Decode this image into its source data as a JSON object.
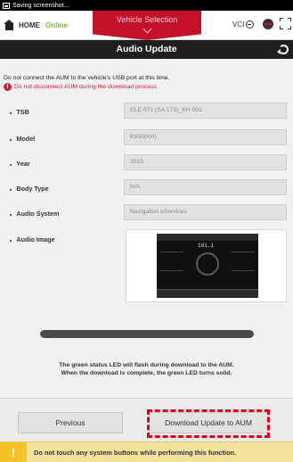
{
  "statusbar": {
    "text": "Saving screenshot..."
  },
  "nav": {
    "home_label": "HOME",
    "online_label": "Online",
    "vehicle_selection_label": "Vehicle Selection",
    "vci_label": "VCI"
  },
  "title": "Audio Update",
  "notices": {
    "line1": "Do not connect the AUM to the vehicle's USB port at this time.",
    "line2": "Do not disconnect AUM during the download process."
  },
  "fields": [
    {
      "label": "TSB",
      "value": "ELE 071 (SA 173)_KH 001"
    },
    {
      "label": "Model",
      "value": "K900(KH)"
    },
    {
      "label": "Year",
      "value": "2015"
    },
    {
      "label": "Body Type",
      "value": "N/A"
    },
    {
      "label": "Audio System",
      "value": "Navigation eServices"
    }
  ],
  "audio_image": {
    "label": "Audio Image",
    "screen_text": "101.1"
  },
  "progress": {
    "fraction": 1.0
  },
  "info": {
    "line1": "The green status LED will flash during download to the AUM.",
    "line2": "When the download is complete, the green LED turns solid."
  },
  "buttons": {
    "previous": "Previous",
    "download": "Download Update to AUM"
  },
  "footer": {
    "warning": "Do not touch any system buttons while performing this function."
  },
  "colors": {
    "accent": "#c3112a",
    "online": "#7dbb2f",
    "warning_red": "#d7202d",
    "highlight": "#e3001b",
    "footer_bg": "#f4e19a"
  }
}
